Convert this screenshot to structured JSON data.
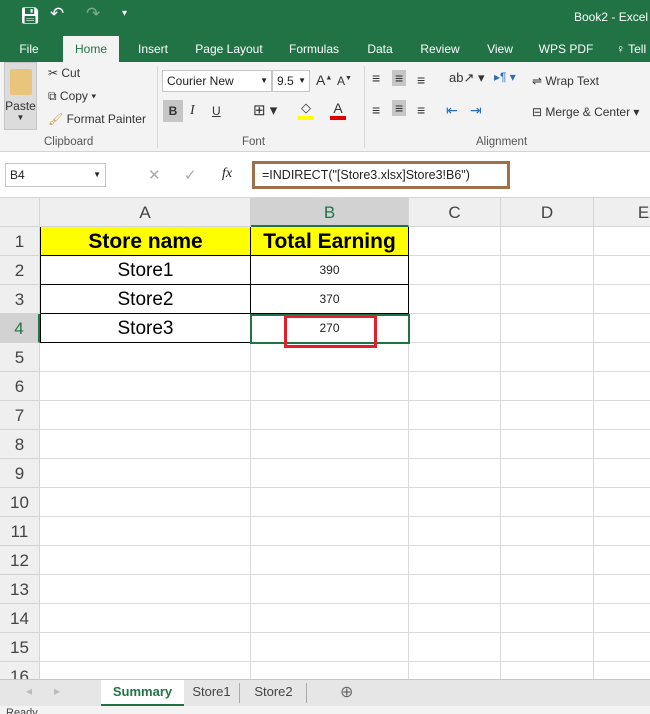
{
  "title": "Book2 - Excel (",
  "ribbon_tabs": [
    "File",
    "Home",
    "Insert",
    "Page Layout",
    "Formulas",
    "Data",
    "Review",
    "View",
    "WPS PDF",
    "Tell"
  ],
  "clipboard": {
    "paste": "Paste",
    "cut": "Cut",
    "copy": "Copy",
    "format_painter": "Format Painter",
    "group": "Clipboard"
  },
  "font": {
    "name": "Courier New",
    "size": "9.5",
    "bold": "B",
    "italic": "I",
    "underline": "U",
    "group": "Font"
  },
  "alignment": {
    "wrap": "Wrap Text",
    "merge": "Merge & Center",
    "group": "Alignment"
  },
  "namebox": "B4",
  "formula": "=INDIRECT(\"[Store3.xlsx]Store3!B6\")",
  "fx": "fx",
  "columns": [
    "A",
    "B",
    "C",
    "D",
    "E"
  ],
  "rows": [
    "1",
    "2",
    "3",
    "4",
    "5",
    "6",
    "7",
    "8",
    "9",
    "10",
    "11",
    "12",
    "13",
    "14",
    "15",
    "16"
  ],
  "table": {
    "headers": [
      "Store name",
      "Total Earning"
    ],
    "rows": [
      [
        "Store1",
        "390"
      ],
      [
        "Store2",
        "370"
      ],
      [
        "Store3",
        "270"
      ]
    ]
  },
  "sheets": [
    "Summary",
    "Store1",
    "Store2"
  ],
  "status": "Ready",
  "colors": {
    "excel_green": "#217346",
    "header_fill": "#ffff00",
    "highlight": "#e0202a",
    "formula_box": "#a0704a"
  }
}
